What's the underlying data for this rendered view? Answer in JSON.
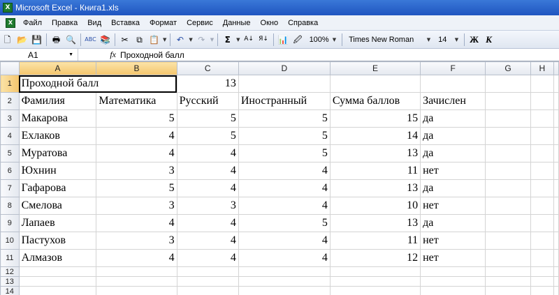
{
  "window": {
    "title": "Microsoft Excel - Книга1.xls"
  },
  "menu": [
    "Файл",
    "Правка",
    "Вид",
    "Вставка",
    "Формат",
    "Сервис",
    "Данные",
    "Окно",
    "Справка"
  ],
  "toolbar": {
    "zoom": "100%",
    "font_name": "Times New Roman",
    "font_size": "14",
    "bold_label": "Ж",
    "italic_label": "К",
    "sum_label": "Σ"
  },
  "formula_bar": {
    "name_box": "A1",
    "fx_label": "fx",
    "content": "Проходной балл"
  },
  "columns": [
    "A",
    "B",
    "C",
    "D",
    "E",
    "F",
    "G",
    "H"
  ],
  "rows": [
    {
      "n": "1",
      "cells": [
        "Проходной балл",
        "",
        "13",
        "",
        "",
        "",
        "",
        ""
      ]
    },
    {
      "n": "2",
      "cells": [
        "Фамилия",
        "Математика",
        "Русский",
        "Иностранный",
        "Сумма баллов",
        "Зачислен",
        "",
        ""
      ]
    },
    {
      "n": "3",
      "cells": [
        "Макарова",
        "5",
        "5",
        "5",
        "15",
        "да",
        "",
        ""
      ]
    },
    {
      "n": "4",
      "cells": [
        "Ехлаков",
        "4",
        "5",
        "5",
        "14",
        "да",
        "",
        ""
      ]
    },
    {
      "n": "5",
      "cells": [
        "Муратова",
        "4",
        "4",
        "5",
        "13",
        "да",
        "",
        ""
      ]
    },
    {
      "n": "6",
      "cells": [
        "Юхнин",
        "3",
        "4",
        "4",
        "11",
        "нет",
        "",
        ""
      ]
    },
    {
      "n": "7",
      "cells": [
        "Гафарова",
        "5",
        "4",
        "4",
        "13",
        "да",
        "",
        ""
      ]
    },
    {
      "n": "8",
      "cells": [
        "Смелова",
        "3",
        "3",
        "4",
        "10",
        "нет",
        "",
        ""
      ]
    },
    {
      "n": "9",
      "cells": [
        "Лапаев",
        "4",
        "4",
        "5",
        "13",
        "да",
        "",
        ""
      ]
    },
    {
      "n": "10",
      "cells": [
        "Пастухов",
        "3",
        "4",
        "4",
        "11",
        "нет",
        "",
        ""
      ]
    },
    {
      "n": "11",
      "cells": [
        "Алмазов",
        "4",
        "4",
        "4",
        "12",
        "нет",
        "",
        ""
      ]
    },
    {
      "n": "12",
      "cells": [
        "",
        "",
        "",
        "",
        "",
        "",
        "",
        ""
      ]
    },
    {
      "n": "13",
      "cells": [
        "",
        "",
        "",
        "",
        "",
        "",
        "",
        ""
      ]
    },
    {
      "n": "14",
      "cells": [
        "",
        "",
        "",
        "",
        "",
        "",
        "",
        ""
      ]
    }
  ],
  "selection": {
    "active_cell": "A1",
    "selected_columns": [
      "A",
      "B"
    ],
    "selected_row": "1"
  },
  "colors": {
    "title_bar": "#2a62cc",
    "selected_header": "#f4c56c",
    "grid_line": "#d4d4d4"
  }
}
